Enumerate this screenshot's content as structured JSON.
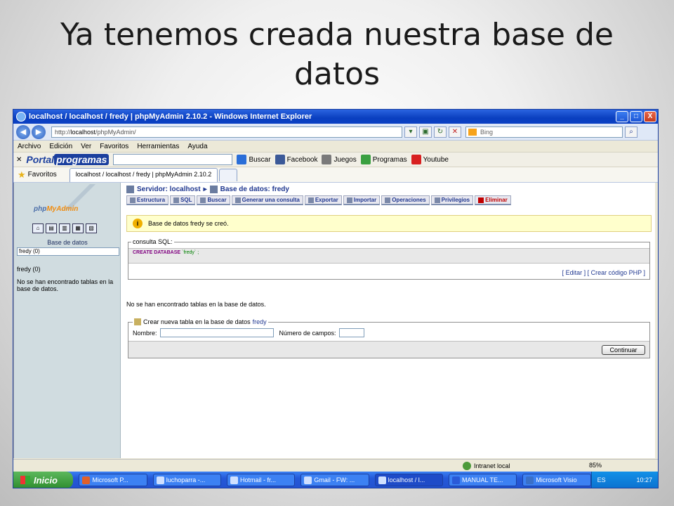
{
  "slide": {
    "title_line1": "Ya tenemos creada nuestra base de",
    "title_line2": "datos"
  },
  "window": {
    "title": "localhost / localhost / fredy | phpMyAdmin 2.10.2 - Windows Internet Explorer",
    "minimize": "_",
    "maximize": "□",
    "close": "X"
  },
  "address": {
    "url_prefix": "http://",
    "url_host": "localhost",
    "url_path": "/phpMyAdmin/",
    "search_placeholder": "Bing"
  },
  "menu": [
    "Archivo",
    "Edición",
    "Ver",
    "Favoritos",
    "Herramientas",
    "Ayuda"
  ],
  "portal_toolbar": {
    "logo_a": "Portal",
    "logo_b": "programas",
    "items": [
      "Buscar",
      "Facebook",
      "Juegos",
      "Programas",
      "Youtube"
    ]
  },
  "favorites": {
    "label": "Favoritos",
    "tab": "localhost / localhost / fredy | phpMyAdmin 2.10.2"
  },
  "sidebar": {
    "logo_a": "php",
    "logo_b": "MyAdmin",
    "db_label": "Base de datos",
    "db_select": "fredy (0)",
    "db_name": "fredy (0)",
    "message": "No se han encontrado tablas en la base de datos."
  },
  "main": {
    "server": "Servidor: localhost",
    "database": "Base de datos: fredy",
    "tabs": [
      "Estructura",
      "SQL",
      "Buscar",
      "Generar una consulta",
      "Exportar",
      "Importar",
      "Operaciones",
      "Privilegios",
      "Eliminar"
    ],
    "notice": "Base de datos fredy se creó.",
    "sql_legend": "consulta SQL:",
    "sql_keyword": "CREATE DATABASE",
    "sql_string": "`fredy`",
    "sql_end": ";",
    "sql_links": "[ Editar ] [ Crear código PHP ]",
    "empty_msg": "No se han encontrado tablas en la base de datos.",
    "create_legend": "Crear nueva tabla en la base de datos",
    "create_db": "fredy",
    "name_label": "Nombre:",
    "fields_label": "Número de campos:",
    "continue": "Continuar"
  },
  "status": {
    "zone": "Intranet local",
    "zoom": "85%"
  },
  "taskbar": {
    "start": "Inicio",
    "tasks": [
      "Microsoft P...",
      "luchoparra -...",
      "Hotmail - fr...",
      "Gmail - FW: ...",
      "localhost / l...",
      "MANUAL TE...",
      "Microsoft Visio"
    ],
    "lang": "ES",
    "clock": "10:27"
  }
}
